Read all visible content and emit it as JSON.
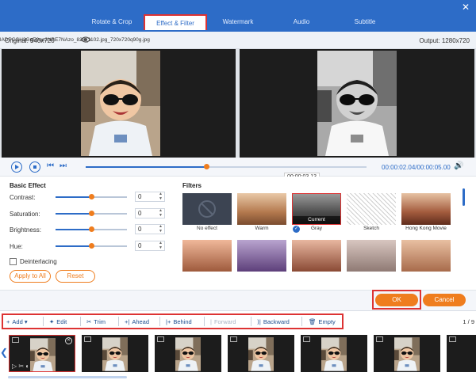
{
  "tabs": [
    {
      "label": "Rotate & Crop"
    },
    {
      "label": "Effect & Filter"
    },
    {
      "label": "Watermark"
    },
    {
      "label": "Audio"
    },
    {
      "label": "Subtitle"
    }
  ],
  "info": {
    "original": "Original: 540x720",
    "filename": "lADPGSH3GgE0qe3NBE7NAzo_826_1102.jpg_720x720q90g.jpg",
    "output": "Output: 1280x720"
  },
  "playback": {
    "time": "00:00:02.04/00:00:05.00",
    "tooltip": "00:00:03.13",
    "progress": 0.43
  },
  "basic_effect": {
    "title": "Basic Effect",
    "sliders": [
      {
        "label": "Contrast:",
        "value": "0",
        "position": 0.5
      },
      {
        "label": "Saturation:",
        "value": "0",
        "position": 0.5
      },
      {
        "label": "Brightness:",
        "value": "0",
        "position": 0.5
      },
      {
        "label": "Hue:",
        "value": "0",
        "position": 0.5
      }
    ],
    "deinterlacing": "Deinterlacing",
    "apply_all": "Apply to All",
    "reset": "Reset"
  },
  "filters": {
    "title": "Filters",
    "current_badge": "Current",
    "items": [
      {
        "name": "No effect"
      },
      {
        "name": "Warm"
      },
      {
        "name": "Gray"
      },
      {
        "name": "Sketch"
      },
      {
        "name": "Hong Kong Movie"
      }
    ]
  },
  "actions": {
    "ok": "OK",
    "cancel": "Cancel"
  },
  "toolbar": {
    "add": "Add",
    "edit": "Edit",
    "trim": "Trim",
    "ahead": "Ahead",
    "behind": "Behind",
    "forward": "Forward",
    "backward": "Backward",
    "empty": "Empty",
    "page": "1 / 9"
  },
  "colors": {
    "accent_blue": "#2d6cc7",
    "orange": "#ef7d1e",
    "highlight_red": "#dd3333"
  }
}
